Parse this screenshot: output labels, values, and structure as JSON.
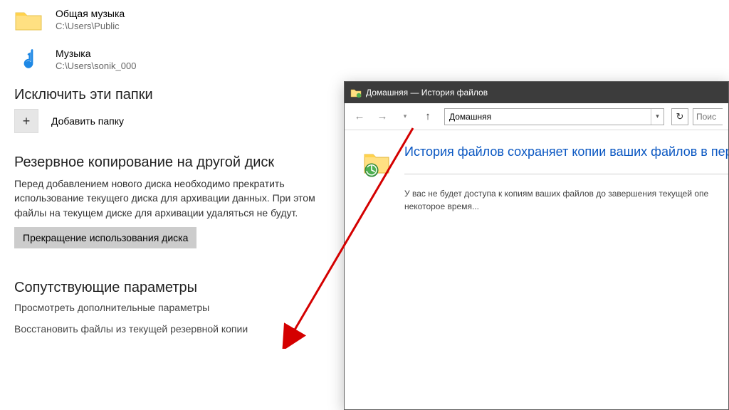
{
  "folders": [
    {
      "title": "Общая музыка",
      "path": "C:\\Users\\Public"
    },
    {
      "title": "Музыка",
      "path": "C:\\Users\\sonik_000"
    }
  ],
  "exclude": {
    "heading": "Исключить эти папки",
    "add_label": "Добавить папку"
  },
  "backup_other": {
    "heading": "Резервное копирование на другой диск",
    "body": "Перед добавлением нового диска необходимо прекратить использование текущего диска для архивации данных. При этом файлы на текущем диске для архивации удаляться не будут.",
    "button": "Прекращение использования диска"
  },
  "related": {
    "heading": "Сопутствующие параметры",
    "link_more": "Просмотреть дополнительные параметры",
    "link_restore": "Восстановить файлы из текущей резервной копии"
  },
  "fh_window": {
    "title": "Домашняя — История файлов",
    "address": "Домашняя",
    "search_placeholder": "Поис",
    "headline": "История файлов сохраняет копии ваших файлов в перв",
    "message": "У вас не будет доступа к копиям ваших файлов до завершения текущей опе некоторое время..."
  }
}
